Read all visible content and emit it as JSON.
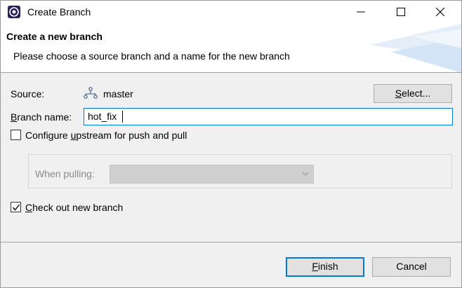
{
  "window": {
    "title": "Create Branch"
  },
  "header": {
    "title": "Create a new branch",
    "message": "Please choose a source branch and a name for the new branch"
  },
  "source": {
    "label": "Source:",
    "value": "master",
    "icon": "branch-icon"
  },
  "select_button": {
    "mnemonic": "S",
    "rest": "elect..."
  },
  "branch_name": {
    "label_mnemonic": "B",
    "label_rest": "ranch name:",
    "value": "hot_fix"
  },
  "configure_upstream": {
    "checked": false,
    "label_pre": "Configure ",
    "label_mnemonic": "u",
    "label_post": "pstream for push and pull"
  },
  "when_pulling": {
    "label": "When pulling:",
    "value": ""
  },
  "checkout": {
    "checked": true,
    "label_mnemonic": "C",
    "label_rest": "heck out new branch"
  },
  "buttons": {
    "finish_mnemonic": "F",
    "finish_rest": "inish",
    "cancel": "Cancel"
  },
  "colors": {
    "accent": "#0078d7",
    "dialog_bg": "#f0f0f0",
    "header_bg": "#ffffff"
  }
}
